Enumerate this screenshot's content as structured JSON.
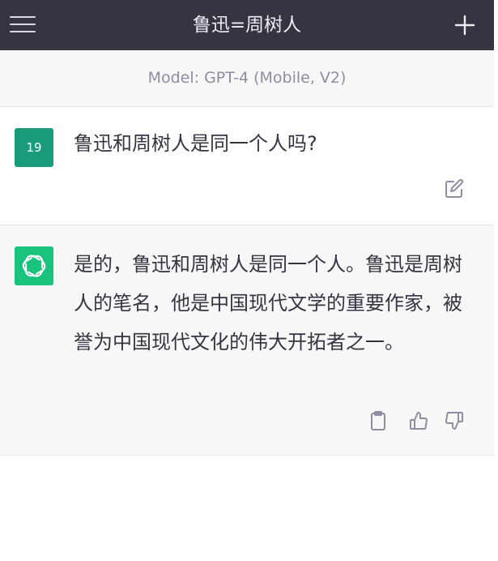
{
  "header": {
    "title": "鲁迅=周树人",
    "menu_icon": "hamburger-menu-icon",
    "new_chat_icon": "plus-icon"
  },
  "model_info": {
    "label": "Model: GPT-4 (Mobile, V2)"
  },
  "conversation": {
    "user_message": {
      "avatar_text": "19",
      "avatar_color": "#1a9c7b",
      "text": "鲁迅和周树人是同一个人吗?",
      "edit_icon": "edit-icon"
    },
    "assistant_message": {
      "avatar_icon": "openai-logo-icon",
      "avatar_color": "#19c37d",
      "text": "是的，鲁迅和周树人是同一个人。鲁迅是周树人的笔名，他是中国现代文学的重要作家，被誉为中国现代文化的伟大开拓者之一。",
      "actions": [
        "copy-icon",
        "thumbs-up-icon",
        "thumbs-down-icon"
      ]
    }
  },
  "colors": {
    "header_bg": "#343541",
    "accent": "#19c37d",
    "muted_text": "#8e8ea0"
  }
}
